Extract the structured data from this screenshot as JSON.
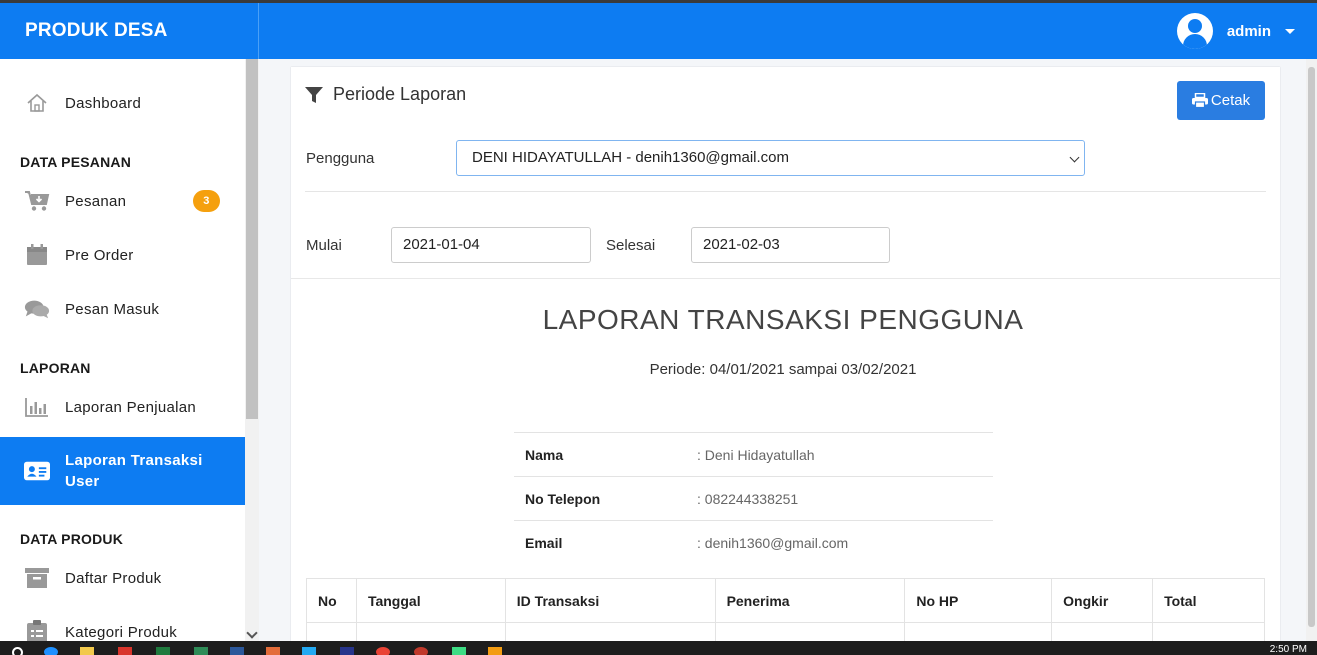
{
  "topbar": {
    "brand": "PRODUK DESA",
    "user": "admin"
  },
  "sidebar": {
    "items": [
      {
        "label": "Dashboard",
        "icon": "home-icon"
      },
      {
        "section": "DATA PESANAN"
      },
      {
        "label": "Pesanan",
        "icon": "cart-icon",
        "badge": "3"
      },
      {
        "label": "Pre Order",
        "icon": "calendar-icon"
      },
      {
        "label": "Pesan Masuk",
        "icon": "chat-icon"
      },
      {
        "section": "LAPORAN"
      },
      {
        "label": "Laporan Penjualan",
        "icon": "bar-chart-icon"
      },
      {
        "label": "Laporan Transaksi User",
        "icon": "id-card-icon",
        "active": true
      },
      {
        "section": "DATA PRODUK"
      },
      {
        "label": "Daftar Produk",
        "icon": "archive-icon"
      },
      {
        "label": "Kategori Produk",
        "icon": "clipboard-icon"
      }
    ],
    "labels": {
      "dashboard": "Dashboard",
      "sec_pesanan": "DATA PESANAN",
      "pesanan": "Pesanan",
      "pesanan_badge": "3",
      "pre_order": "Pre Order",
      "pesan_masuk": "Pesan Masuk",
      "sec_laporan": "LAPORAN",
      "laporan_penjualan": "Laporan Penjualan",
      "laporan_transaksi_1": "Laporan Transaksi",
      "laporan_transaksi_2": "User",
      "sec_produk": "DATA PRODUK",
      "daftar_produk": "Daftar Produk",
      "kategori_produk": "Kategori Produk"
    }
  },
  "filter": {
    "title": "Periode Laporan",
    "print_label": "Cetak",
    "user_label": "Pengguna",
    "user_selected": "DENI HIDAYATULLAH - denih1360@gmail.com",
    "start_label": "Mulai",
    "start_value": "2021-01-04",
    "end_label": "Selesai",
    "end_value": "2021-02-03"
  },
  "report": {
    "title": "LAPORAN TRANSAKSI PENGGUNA",
    "period": "Periode: 04/01/2021 sampai 03/02/2021",
    "info": {
      "name_label": "Nama",
      "name_value": ": Deni Hidayatullah",
      "phone_label": "No Telepon",
      "phone_value": ": 082244338251",
      "email_label": "Email",
      "email_value": ": denih1360@gmail.com"
    },
    "columns": [
      "No",
      "Tanggal",
      "ID Transaksi",
      "Penerima",
      "No HP",
      "Ongkir",
      "Total"
    ]
  },
  "colors": {
    "primary": "#0d7cf2",
    "badge": "#f5a00e",
    "button": "#2a7de1"
  },
  "taskbar": {
    "clock": "2:50 PM"
  }
}
